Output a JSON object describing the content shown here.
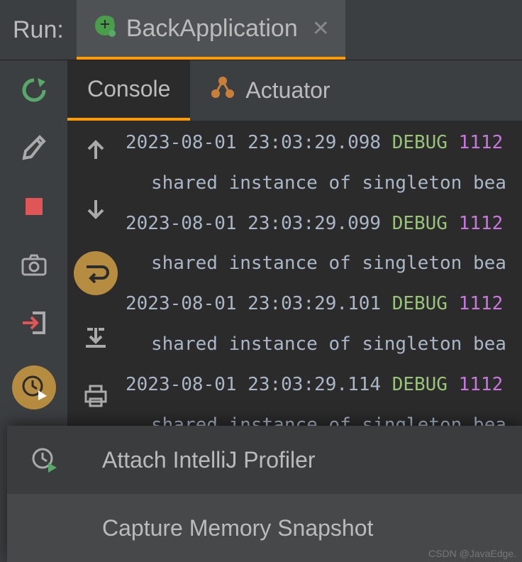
{
  "header": {
    "run_label": "Run:",
    "tab_title": "BackApplication"
  },
  "sub_tabs": {
    "console": "Console",
    "actuator": "Actuator"
  },
  "console": {
    "lines": [
      {
        "timestamp": "2023-08-01 23:03:29.098",
        "level": "DEBUG",
        "pid": "1112",
        "indented": false
      },
      {
        "msg": "shared instance of singleton bea",
        "indented": true
      },
      {
        "timestamp": "2023-08-01 23:03:29.099",
        "level": "DEBUG",
        "pid": "1112",
        "indented": false
      },
      {
        "msg": "shared instance of singleton bea",
        "indented": true
      },
      {
        "timestamp": "2023-08-01 23:03:29.101",
        "level": "DEBUG",
        "pid": "1112",
        "indented": false
      },
      {
        "msg": "shared instance of singleton bea",
        "indented": true
      },
      {
        "timestamp": "2023-08-01 23:03:29.114",
        "level": "DEBUG",
        "pid": "1112",
        "indented": false
      },
      {
        "msg": "shared instance of singleton bea",
        "indented": true
      }
    ]
  },
  "menu": {
    "attach_profiler": "Attach IntelliJ Profiler",
    "capture_memory": "Capture Memory Snapshot"
  },
  "watermark": "CSDN @JavaEdge."
}
